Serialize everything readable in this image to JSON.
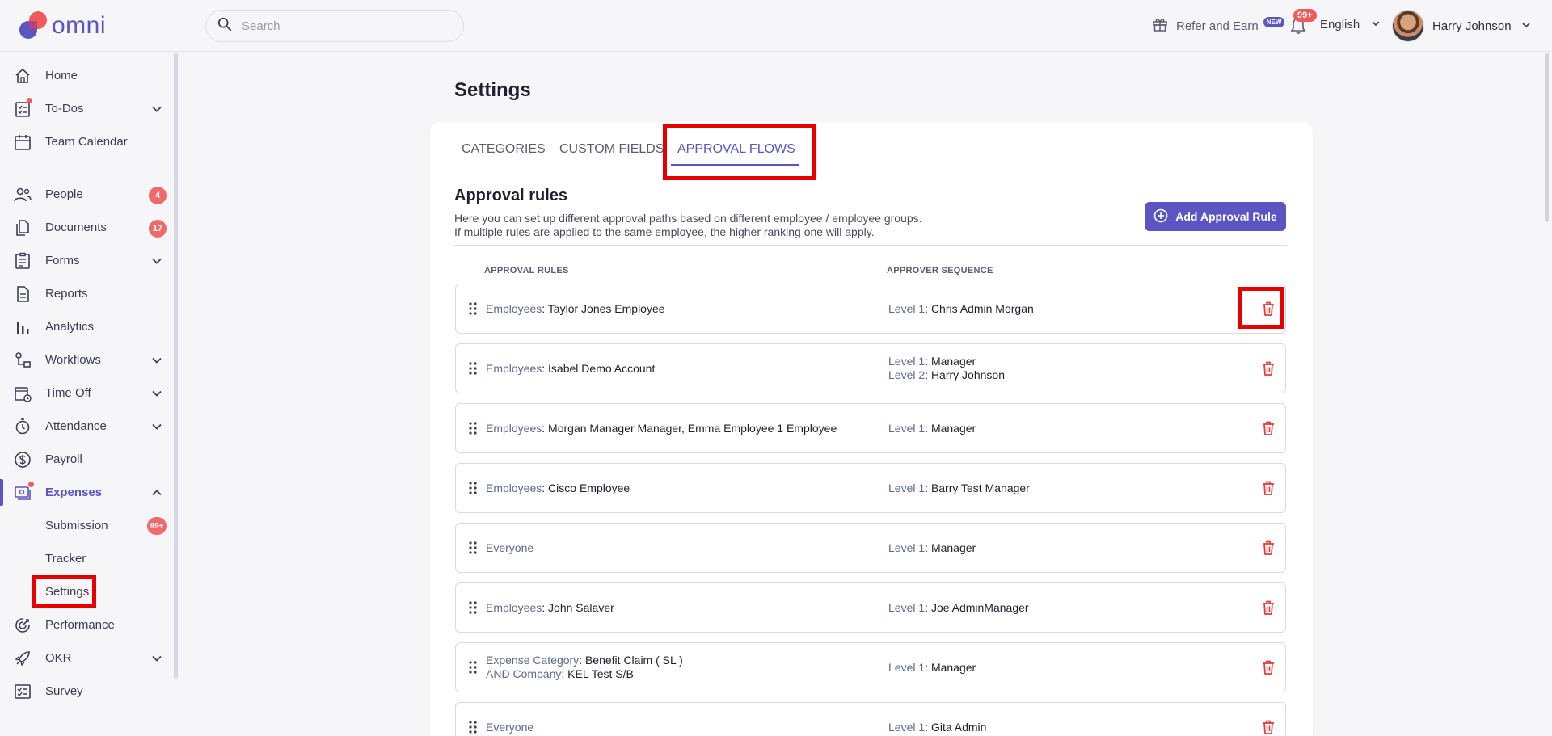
{
  "app": {
    "logo_text": "omni",
    "brand_color": "#5a55c2",
    "accent_red": "#ef5a5a"
  },
  "header": {
    "search_placeholder": "Search",
    "refer_label": "Refer and Earn",
    "new_badge": "NEW",
    "notification_count": "99+",
    "language": "English",
    "user_name": "Harry Johnson"
  },
  "sidebar": {
    "home": "Home",
    "todos": "To-Dos",
    "team_calendar": "Team Calendar",
    "people": "People",
    "people_count": "4",
    "documents": "Documents",
    "documents_count": "17",
    "forms": "Forms",
    "reports": "Reports",
    "analytics": "Analytics",
    "workflows": "Workflows",
    "time_off": "Time Off",
    "attendance": "Attendance",
    "payroll": "Payroll",
    "expenses": "Expenses",
    "submission": "Submission",
    "submission_count": "99+",
    "tracker": "Tracker",
    "settings": "Settings",
    "performance": "Performance",
    "okr": "OKR",
    "survey": "Survey"
  },
  "page": {
    "title": "Settings",
    "tabs": [
      "CATEGORIES",
      "CUSTOM FIELDS",
      "APPROVAL FLOWS"
    ],
    "active_tab": "APPROVAL FLOWS",
    "section_title": "Approval rules",
    "desc_line1": "Here you can set up different approval paths based on different employee / employee groups.",
    "desc_line2": "If multiple rules are applied to the same employee, the higher ranking one will apply.",
    "add_button": "Add Approval Rule",
    "col_rules": "APPROVAL RULES",
    "col_sequence": "APPROVER SEQUENCE"
  },
  "rules": [
    {
      "r1k": "Employees",
      "r1v": "Taylor Jones Employee",
      "a1k": "Level 1",
      "a1v": "Chris Admin Morgan"
    },
    {
      "r1k": "Employees",
      "r1v": "Isabel Demo Account",
      "a1k": "Level 1",
      "a1v": "Manager",
      "a2k": "Level 2",
      "a2v": "Harry Johnson"
    },
    {
      "r1k": "Employees",
      "r1v": "Morgan Manager Manager, Emma Employee 1 Employee",
      "a1k": "Level 1",
      "a1v": "Manager"
    },
    {
      "r1k": "Employees",
      "r1v": "Cisco Employee",
      "a1k": "Level 1",
      "a1v": "Barry Test Manager"
    },
    {
      "r1k": "Everyone",
      "a1k": "Level 1",
      "a1v": "Manager"
    },
    {
      "r1k": "Employees",
      "r1v": "John Salaver",
      "a1k": "Level 1",
      "a1v": "Joe AdminManager"
    },
    {
      "r1k": "Expense Category",
      "r1v": "Benefit Claim ( SL )",
      "r2k": "AND Company",
      "r2v": "KEL Test S/B",
      "a1k": "Level 1",
      "a1v": "Manager"
    },
    {
      "r1k": "Everyone",
      "a1k": "Level 1",
      "a1v": "Gita Admin"
    }
  ]
}
